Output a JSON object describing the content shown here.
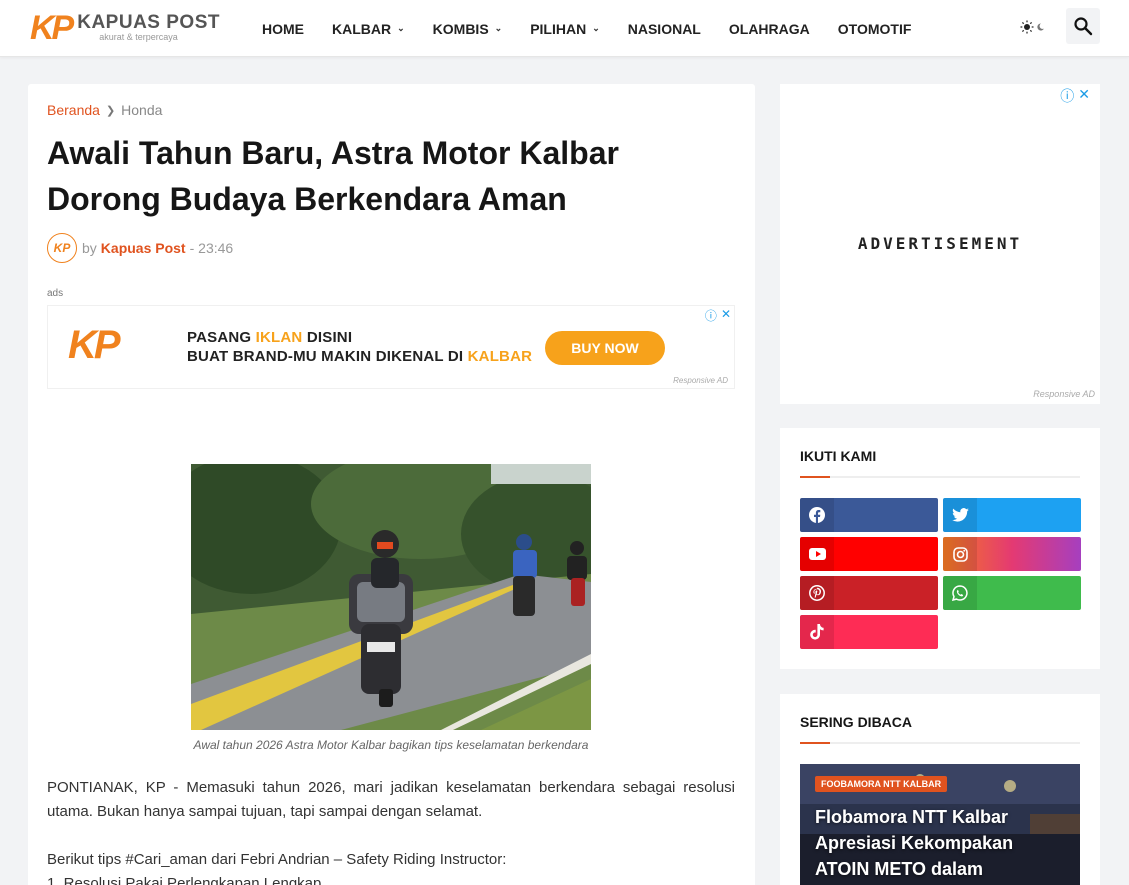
{
  "header": {
    "logo_mark": "KP",
    "logo_name": "KAPUAS POST",
    "logo_tagline": "akurat & terpercaya",
    "nav": [
      {
        "label": "HOME",
        "dropdown": false
      },
      {
        "label": "KALBAR",
        "dropdown": true
      },
      {
        "label": "KOMBIS",
        "dropdown": true
      },
      {
        "label": "PILIHAN",
        "dropdown": true
      },
      {
        "label": "NASIONAL",
        "dropdown": false
      },
      {
        "label": "OLAHRAGA",
        "dropdown": false
      },
      {
        "label": "OTOMOTIF",
        "dropdown": false
      }
    ],
    "theme_icon": "sun-moon-icon",
    "search_icon": "search-icon"
  },
  "breadcrumb": {
    "home": "Beranda",
    "current": "Honda"
  },
  "article": {
    "title": "Awali Tahun Baru, Astra Motor Kalbar Dorong Budaya Berkendara Aman",
    "by_prefix": "by",
    "author": "Kapuas Post",
    "time": "- 23:46",
    "avatar_text": "KP",
    "ads_label": "ads",
    "caption": "Awal tahun 2026 Astra Motor Kalbar bagikan tips keselamatan berkendara",
    "paragraph1": "PONTIANAK, KP - Memasuki tahun 2026, mari jadikan keselamatan berkendara sebagai resolusi utama. Bukan hanya sampai tujuan, tapi sampai dengan selamat.",
    "paragraph2": "Berikut tips #Cari_aman dari Febri Andrian – Safety Riding Instructor:",
    "paragraph3": "1. Resolusi Pakai Perlengkapan Lengkap"
  },
  "ad_banner": {
    "logo": "KP",
    "line1_a": "PASANG ",
    "line1_b": "IKLAN",
    "line1_c": " DISINI",
    "line2_a": "BUAT BRAND-MU MAKIN DIKENAL DI ",
    "line2_b": "KALBAR",
    "button": "BUY NOW",
    "responsive": "Responsive AD",
    "colors": {
      "accent": "#f7a21b"
    }
  },
  "sidebar": {
    "ad_text": "ADVERTISEMENT",
    "ad_responsive": "Responsive AD",
    "follow_title": "IKUTI KAMI",
    "socials": [
      {
        "name": "facebook",
        "icon": "facebook-icon",
        "color": "#3b5998"
      },
      {
        "name": "twitter",
        "icon": "twitter-icon",
        "color": "#1da1f2"
      },
      {
        "name": "youtube",
        "icon": "youtube-icon",
        "color": "#ff0000"
      },
      {
        "name": "instagram",
        "icon": "instagram-icon",
        "color": "#e43a72"
      },
      {
        "name": "pinterest",
        "icon": "pinterest-icon",
        "color": "#ca2127"
      },
      {
        "name": "whatsapp",
        "icon": "whatsapp-icon",
        "color": "#3fbb4c"
      },
      {
        "name": "tiktok",
        "icon": "tiktok-icon",
        "color": "#fe2c55"
      }
    ],
    "popular_title": "SERING DIBACA",
    "popular_badge": "FOOBAMORA NTT KALBAR",
    "popular_headline": "Flobamora NTT Kalbar Apresiasi Kekompakan ATOIN METO dalam"
  },
  "colors": {
    "brand_orange": "#f0821e",
    "link_red": "#e0531f"
  }
}
